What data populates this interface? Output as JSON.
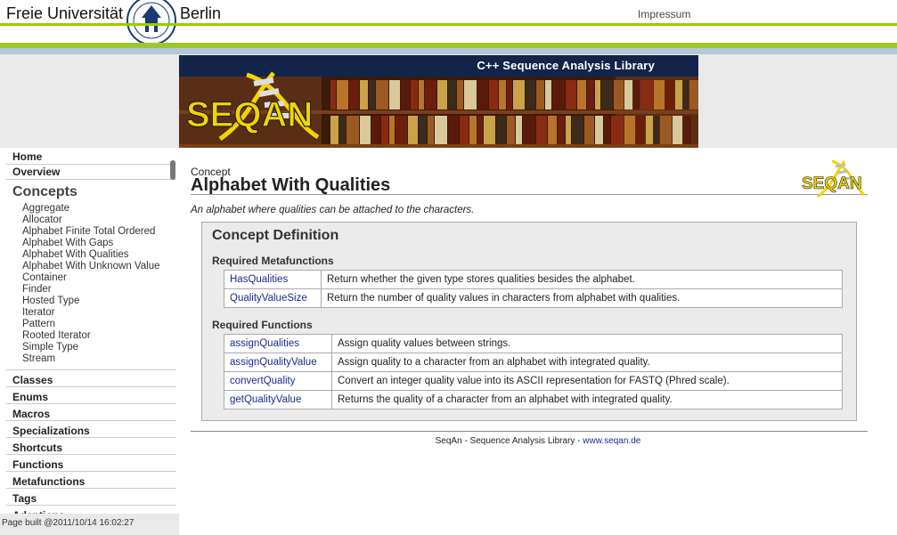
{
  "header": {
    "university_left": "Freie Universität",
    "university_right": "Berlin",
    "impressum": "Impressum"
  },
  "banner": {
    "caption": "C++ Sequence Analysis Library",
    "logo_text": "SEQAN"
  },
  "sidebar": {
    "home": "Home",
    "overview": "Overview",
    "concepts_heading": "Concepts",
    "concepts": [
      "Aggregate",
      "Allocator",
      "Alphabet Finite Total Ordered",
      "Alphabet With Gaps",
      "Alphabet With Qualities",
      "Alphabet With Unknown Value",
      "Container",
      "Finder",
      "Hosted Type",
      "Iterator",
      "Pattern",
      "Rooted Iterator",
      "Simple Type",
      "Stream"
    ],
    "sections": [
      "Classes",
      "Enums",
      "Macros",
      "Specializations",
      "Shortcuts",
      "Functions",
      "Metafunctions",
      "Tags",
      "Adaptions"
    ],
    "page_built": "Page built @2011/10/14 16:02:27"
  },
  "main": {
    "kind": "Concept",
    "title": "Alphabet With Qualities",
    "logo_text": "SEQAN",
    "intro": "An alphabet where qualities can be attached to the characters.",
    "definition": {
      "heading": "Concept Definition",
      "metafunctions_heading": "Required Metafunctions",
      "metafunctions": [
        {
          "name": "HasQualities",
          "desc": "Return whether the given type stores qualities besides the alphabet."
        },
        {
          "name": "QualityValueSize",
          "desc": "Return the number of quality values in characters from alphabet with qualities."
        }
      ],
      "functions_heading": "Required Functions",
      "functions": [
        {
          "name": "assignQualities",
          "desc": "Assign quality values between strings."
        },
        {
          "name": "assignQualityValue",
          "desc": "Assign quality to a character from an alphabet with integrated quality."
        },
        {
          "name": "convertQuality",
          "desc": "Convert an integer quality value into its ASCII representation for FASTQ (Phred scale)."
        },
        {
          "name": "getQualityValue",
          "desc": "Returns the quality of a character from an alphabet with integrated quality."
        }
      ]
    },
    "footer_text": "SeqAn - Sequence Analysis Library - ",
    "footer_link": "www.seqan.de"
  },
  "colors": {
    "fu_green": "#99cc00",
    "banner_navy": "#13244a",
    "link_blue": "#1a2a8c",
    "seqan_yellow": "#f2d400"
  }
}
